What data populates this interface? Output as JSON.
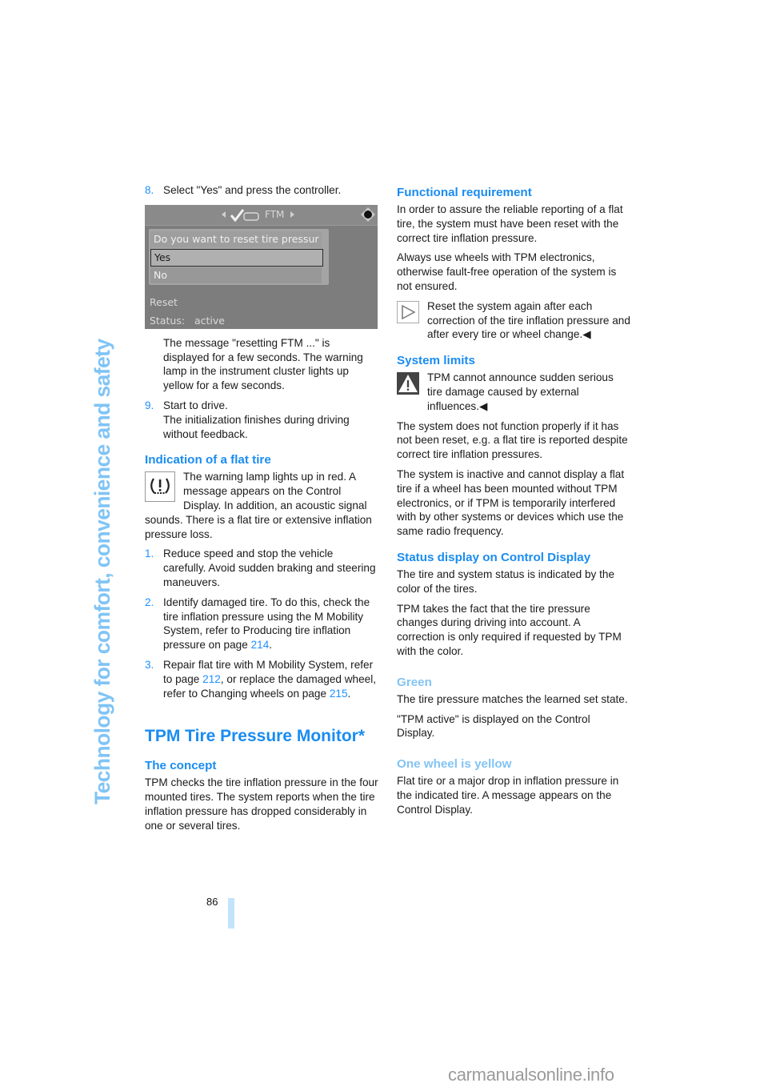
{
  "side_title": "Technology for comfort, convenience and safety",
  "left_column": {
    "step8": {
      "num": "8.",
      "text": "Select \"Yes\" and press the controller."
    },
    "screen": {
      "title": "FTM",
      "question": "Do you want to reset tire pressur",
      "options": [
        "Yes",
        "No"
      ],
      "selected": "Yes",
      "reset_label": "Reset",
      "status_label": "Status:",
      "status_value": "active"
    },
    "step8_note": "The message \"resetting FTM ...\" is displayed for a few seconds. The warning lamp in the instrument cluster lights up yellow for a few seconds.",
    "step9": {
      "num": "9.",
      "line1": "Start to drive.",
      "line2": "The initialization finishes during driving without feedback."
    },
    "flat_tire_heading": "Indication of a flat tire",
    "flat_tire_para": "The warning lamp lights up in red. A message appears on the Control Display. In addition, an acoustic signal sounds. There is a flat tire or extensive inflation pressure loss.",
    "steps": [
      {
        "num": "1.",
        "text": "Reduce speed and stop the vehicle carefully. Avoid sudden braking and steering maneuvers."
      },
      {
        "num": "2.",
        "text_before": "Identify damaged tire. To do this, check the tire inflation pressure using the M Mobility System, refer to Producing tire inflation pressure on page ",
        "page": "214",
        "text_after": "."
      },
      {
        "num": "3.",
        "text_before": "Repair flat tire with M Mobility System, refer to page ",
        "page1": "212",
        "text_mid": ", or replace the damaged wheel, refer to Changing wheels on page ",
        "page2": "215",
        "text_after": "."
      }
    ],
    "chapter_heading": "TPM Tire Pressure Monitor*",
    "concept_heading": "The concept",
    "concept_para": "TPM checks the tire inflation pressure in the four mounted tires. The system reports when the tire inflation pressure has dropped considerably in one or several tires."
  },
  "right_column": {
    "func_req_heading": "Functional requirement",
    "func_req_para1": "In order to assure the reliable reporting of a flat tire, the system must have been reset with the correct tire inflation pressure.",
    "func_req_para2": "Always use wheels with TPM electronics, otherwise fault-free operation of the system is not ensured.",
    "func_req_note": "Reset the system again after each correction of the tire inflation pressure and after every tire or wheel change.",
    "end_mark": "◀",
    "limits_heading": "System limits",
    "limits_warning": "TPM cannot announce sudden serious tire damage caused by external influences.",
    "limits_para1": "The system does not function properly if it has not been reset, e.g. a flat tire is reported despite correct tire inflation pressures.",
    "limits_para2": "The system is inactive and cannot display a flat tire if a wheel has been mounted without TPM electronics, or if TPM is temporarily interfered with by other systems or devices which use the same radio frequency.",
    "status_heading": "Status display on Control Display",
    "status_para1": "The tire and system status is indicated by the color of the tires.",
    "status_para2": "TPM takes the fact that the tire pressure changes during driving into account. A correction is only required if requested by TPM with the color.",
    "green_heading": "Green",
    "green_para1": "The tire pressure matches the learned set state.",
    "green_para2": "\"TPM active\" is displayed on the Control Display.",
    "yellow_heading": "One wheel is yellow",
    "yellow_para": "Flat tire or a major drop in inflation pressure in the indicated tire. A message appears on the Control Display."
  },
  "footer": {
    "page_number": "86",
    "watermark": "carmanualsonline.info"
  },
  "colors": {
    "accent": "#1a8cf0",
    "accent_light": "#82c4f4",
    "side_title": "#80c4f5",
    "page_bar": "#c3e2fb"
  }
}
